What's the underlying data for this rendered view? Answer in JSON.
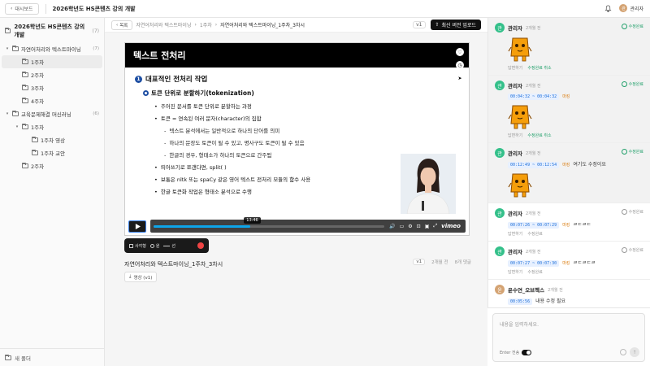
{
  "topbar": {
    "back_label": "대시보드",
    "title": "2026학년도 HS콘텐츠 강의 개발",
    "user_name": "관리자",
    "user_initial": "관"
  },
  "sidebar": {
    "course_title": "2026학년도 HS콘텐츠 강의 개발",
    "course_count": "(7)",
    "tree": [
      {
        "label": "자연어처리와 텍스트마이닝",
        "count": "(7)",
        "level": 0,
        "chevron": "▾"
      },
      {
        "label": "1주차",
        "count": "",
        "level": 1,
        "chevron": ""
      },
      {
        "label": "2주차",
        "count": "",
        "level": 1,
        "chevron": ""
      },
      {
        "label": "3주차",
        "count": "",
        "level": 1,
        "chevron": ""
      },
      {
        "label": "4주차",
        "count": "",
        "level": 1,
        "chevron": ""
      },
      {
        "label": "교육문제해결 머신러닝",
        "count": "(6)",
        "level": 0,
        "chevron": "▾"
      },
      {
        "label": "1주차",
        "count": "",
        "level": 1,
        "chevron": "▾"
      },
      {
        "label": "1주차 영상",
        "count": "",
        "level": 2,
        "chevron": ""
      },
      {
        "label": "1주차 교안",
        "count": "",
        "level": 2,
        "chevron": ""
      },
      {
        "label": "2주차",
        "count": "",
        "level": 1,
        "chevron": ""
      }
    ],
    "new_folder_label": "새 폴더"
  },
  "crumbbar": {
    "list_label": "목록",
    "crumbs": [
      "자연어처리와 텍스트마이닝",
      "1주차",
      "자연어처리와 텍스트마이닝_1주차_3차시"
    ],
    "version": "v1",
    "upload_label": "최신 버전 업로드"
  },
  "slide": {
    "title": "텍스트 전처리",
    "heading": "대표적인 전처리 작업",
    "heading_num": "1",
    "subheading": "토큰 단위로 분할하기(tokenization)",
    "bullets": [
      {
        "text": "주어진 문서를 토큰 단위로 분할하는 과정",
        "level": 1
      },
      {
        "text": "토큰 = 연속된 여러 문자(character)의 집합",
        "level": 1
      },
      {
        "text": "텍스트 분석에서는 일반적으로 하나의 단어를 의미",
        "level": 2
      },
      {
        "text": "하나의 문장도 토큰이 될 수 있고, 명사구도 토큰이 될 수 있음",
        "level": 2
      },
      {
        "text": "한글의 경우, 형태소가 하나의 토큰으로 간주됨",
        "level": 2
      },
      {
        "text": "띄어쓰기로 쪼갠다면, split( )",
        "level": 1
      },
      {
        "text": "보통은 nltk 또는 spaCy 같은 영어 텍스트 전처리 모듈의 함수 사용",
        "level": 1
      },
      {
        "text": "한글 토큰화 작업은 형태소 분석으로 수행",
        "level": 1
      }
    ]
  },
  "player": {
    "current_time": "13:46",
    "progress": 0.42,
    "brand": "vimeo"
  },
  "tools": {
    "rect_label": "사각형",
    "circle_label": "원",
    "line_label": "선"
  },
  "video_info": {
    "title": "자연어처리와 텍스트마이닝_1주차_3차시",
    "version": "v1",
    "age": "2개월 전",
    "comments": "8개 댓글",
    "attach_label": "영상 (v1)"
  },
  "comments": [
    {
      "name": "관리자",
      "time": "2개월 전",
      "initial": "관",
      "status": "수정완료",
      "status_done": true,
      "ts": "",
      "mark": "",
      "text": "",
      "sticker": true,
      "actions": [
        "답변하기",
        "수정완료 취소"
      ],
      "highlight": false,
      "avatar": "green"
    },
    {
      "name": "관리자",
      "time": "2개월 전",
      "initial": "관",
      "status": "수정완료",
      "status_done": true,
      "ts": "00:04:32 ~ 00:04:32",
      "mark": "마킹",
      "text": "",
      "sticker": true,
      "actions": [
        "답변하기",
        "수정완료 취소"
      ],
      "highlight": false,
      "avatar": "green"
    },
    {
      "name": "관리자",
      "time": "2개월 전",
      "initial": "관",
      "status": "수정완료",
      "status_done": true,
      "ts": "00:12:49 ~ 00:12:54",
      "mark": "마킹",
      "text": "여기도 수정이요",
      "sticker": true,
      "actions": [],
      "highlight": false,
      "avatar": "green"
    },
    {
      "name": "관리자",
      "time": "2개월 전",
      "initial": "관",
      "status": "수정완료",
      "status_done": false,
      "ts": "00:07:26 ~ 00:07:29",
      "mark": "마킹",
      "text": "ㄹㄷㄹㄷ",
      "sticker": false,
      "actions": [
        "답변하기",
        "수정완료"
      ],
      "highlight": true,
      "avatar": "green"
    },
    {
      "name": "관리자",
      "time": "2개월 전",
      "initial": "관",
      "status": "수정완료",
      "status_done": false,
      "ts": "00:07:27 ~ 00:07:30",
      "mark": "마킹",
      "text": "ㄹㄷㄹㄷㄹ",
      "sticker": false,
      "actions": [
        "답변하기",
        "수정완료"
      ],
      "highlight": true,
      "avatar": "green"
    },
    {
      "name": "윤수연_오브젝스",
      "time": "2개월 전",
      "initial": "윤",
      "status": "",
      "status_done": false,
      "ts": "00:05:56",
      "mark": "",
      "text": "내용 수정 필요",
      "sticker": false,
      "actions": [],
      "highlight": true,
      "avatar": "orange"
    }
  ],
  "composer": {
    "placeholder": "내용을 입력하세요.",
    "enter_label": "Enter 전송"
  },
  "colors": {
    "accent_blue": "#1e4fa3",
    "done_green": "#22a06b",
    "timestamp_blue": "#1e6fd9",
    "mark_orange": "#d97706",
    "record_red": "#ef4444"
  }
}
